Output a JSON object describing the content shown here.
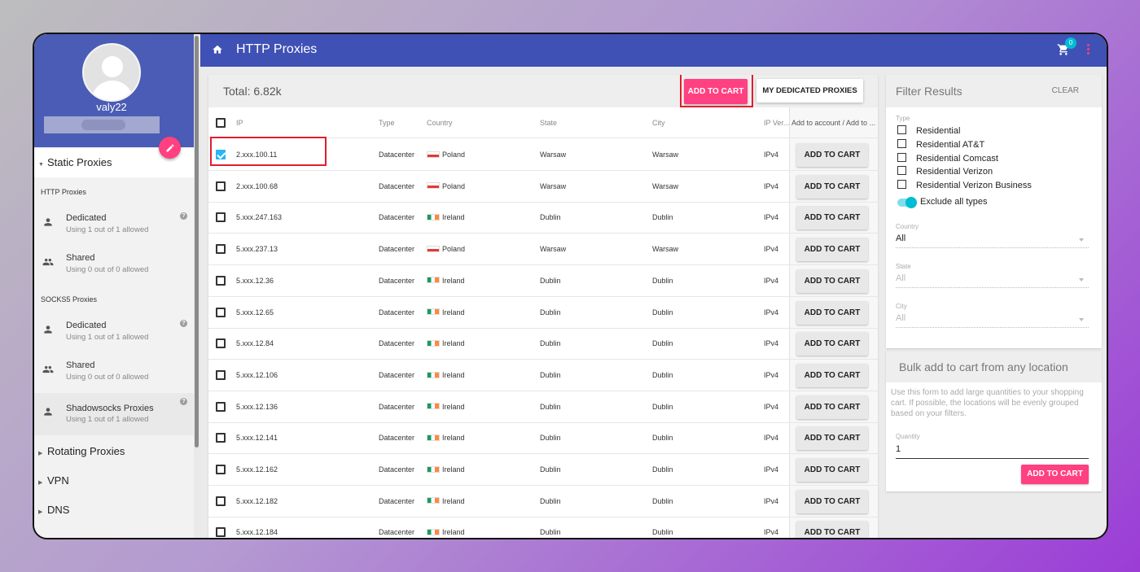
{
  "colors": {
    "accent": "#ff4081",
    "primary": "#3f51b5",
    "badge": "#00bcd4",
    "highlight": "#e01e2d"
  },
  "sidebar": {
    "username": "valy22",
    "static_proxies": "Static Proxies",
    "http_heading": "HTTP Proxies",
    "socks_heading": "SOCKS5 Proxies",
    "items": [
      {
        "title": "Dedicated",
        "sub": "Using 1 out of 1 allowed",
        "icon": "person-icon"
      },
      {
        "title": "Shared",
        "sub": "Using 0 out of 0 allowed",
        "icon": "people-icon"
      },
      {
        "title": "Dedicated",
        "sub": "Using 1 out of 1 allowed",
        "icon": "person-icon"
      },
      {
        "title": "Shared",
        "sub": "Using 0 out of 0 allowed",
        "icon": "people-icon"
      },
      {
        "title": "Shadowsocks Proxies",
        "sub": "Using 1 out of 1 allowed",
        "icon": "person-icon"
      }
    ],
    "rotating": "Rotating Proxies",
    "vpn": "VPN",
    "dns": "DNS",
    "help_glyph": "?"
  },
  "topbar": {
    "title": "HTTP Proxies",
    "cart_count": "0"
  },
  "table": {
    "total": "Total: 6.82k",
    "add_to_cart_top": "ADD TO CART",
    "my_dedicated": "MY DEDICATED PROXIES",
    "headers": {
      "ip": "IP",
      "type": "Type",
      "country": "Country",
      "state": "State",
      "city": "City",
      "ipver": "IP Ver...",
      "add": "Add to account / Add to ..."
    },
    "row_button": "ADD TO CART",
    "rows": [
      {
        "ip": "2.xxx.100.11",
        "type": "Datacenter",
        "country": "Poland",
        "flag": "pl",
        "state": "Warsaw",
        "city": "Warsaw",
        "ipver": "IPv4",
        "checked": true
      },
      {
        "ip": "2.xxx.100.68",
        "type": "Datacenter",
        "country": "Poland",
        "flag": "pl",
        "state": "Warsaw",
        "city": "Warsaw",
        "ipver": "IPv4",
        "checked": false
      },
      {
        "ip": "5.xxx.247.163",
        "type": "Datacenter",
        "country": "Ireland",
        "flag": "ie",
        "state": "Dublin",
        "city": "Dublin",
        "ipver": "IPv4",
        "checked": false
      },
      {
        "ip": "5.xxx.237.13",
        "type": "Datacenter",
        "country": "Poland",
        "flag": "pl",
        "state": "Warsaw",
        "city": "Warsaw",
        "ipver": "IPv4",
        "checked": false
      },
      {
        "ip": "5.xxx.12.36",
        "type": "Datacenter",
        "country": "Ireland",
        "flag": "ie",
        "state": "Dublin",
        "city": "Dublin",
        "ipver": "IPv4",
        "checked": false
      },
      {
        "ip": "5.xxx.12.65",
        "type": "Datacenter",
        "country": "Ireland",
        "flag": "ie",
        "state": "Dublin",
        "city": "Dublin",
        "ipver": "IPv4",
        "checked": false
      },
      {
        "ip": "5.xxx.12.84",
        "type": "Datacenter",
        "country": "Ireland",
        "flag": "ie",
        "state": "Dublin",
        "city": "Dublin",
        "ipver": "IPv4",
        "checked": false
      },
      {
        "ip": "5.xxx.12.106",
        "type": "Datacenter",
        "country": "Ireland",
        "flag": "ie",
        "state": "Dublin",
        "city": "Dublin",
        "ipver": "IPv4",
        "checked": false
      },
      {
        "ip": "5.xxx.12.136",
        "type": "Datacenter",
        "country": "Ireland",
        "flag": "ie",
        "state": "Dublin",
        "city": "Dublin",
        "ipver": "IPv4",
        "checked": false
      },
      {
        "ip": "5.xxx.12.141",
        "type": "Datacenter",
        "country": "Ireland",
        "flag": "ie",
        "state": "Dublin",
        "city": "Dublin",
        "ipver": "IPv4",
        "checked": false
      },
      {
        "ip": "5.xxx.12.162",
        "type": "Datacenter",
        "country": "Ireland",
        "flag": "ie",
        "state": "Dublin",
        "city": "Dublin",
        "ipver": "IPv4",
        "checked": false
      },
      {
        "ip": "5.xxx.12.182",
        "type": "Datacenter",
        "country": "Ireland",
        "flag": "ie",
        "state": "Dublin",
        "city": "Dublin",
        "ipver": "IPv4",
        "checked": false
      },
      {
        "ip": "5.xxx.12.184",
        "type": "Datacenter",
        "country": "Ireland",
        "flag": "ie",
        "state": "Dublin",
        "city": "Dublin",
        "ipver": "IPv4",
        "checked": false
      }
    ]
  },
  "filter": {
    "title": "Filter Results",
    "clear": "CLEAR",
    "type_label": "Type",
    "types": [
      "Residential",
      "Residential AT&T",
      "Residential Comcast",
      "Residential Verizon",
      "Residential Verizon Business"
    ],
    "exclude_label": "Exclude all types",
    "exclude_on": true,
    "country_label": "Country",
    "country_value": "All",
    "state_label": "State",
    "state_value": "All",
    "city_label": "City",
    "city_value": "All"
  },
  "bulk": {
    "title": "Bulk add to cart from any location",
    "desc": "Use this form to add large quantities to your shopping cart. If possible, the locations will be evenly grouped based on your filters.",
    "qty_label": "Quantity",
    "qty_value": "1",
    "button": "ADD TO CART"
  }
}
